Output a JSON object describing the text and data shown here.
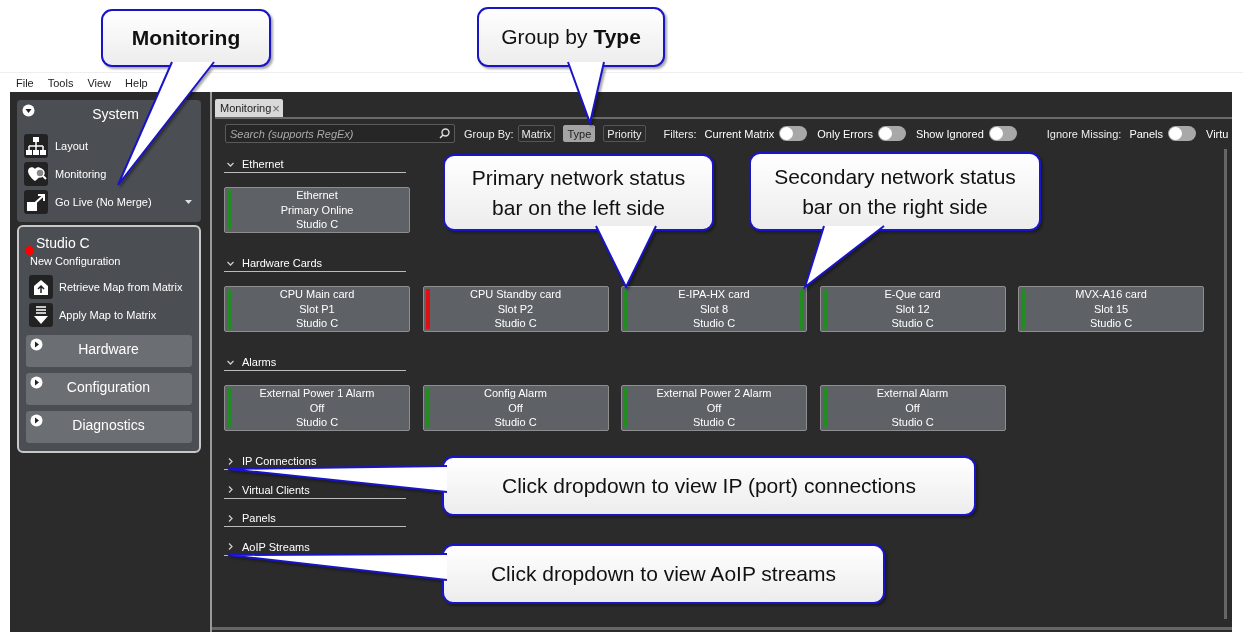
{
  "menu": [
    "File",
    "Tools",
    "View",
    "Help"
  ],
  "sidebar": {
    "system": {
      "title": "System",
      "expanded": true,
      "items": [
        {
          "label": "Layout",
          "dropdown": false
        },
        {
          "label": "Monitoring",
          "dropdown": false
        },
        {
          "label": "Go Live (No Merge)",
          "dropdown": true
        }
      ]
    },
    "matrix": {
      "name": "Studio C",
      "color": "#ff0000",
      "subtitle": "New Configuration",
      "actions": [
        "Retrieve Map from Matrix",
        "Apply Map to Matrix"
      ],
      "sections": [
        {
          "title": "Hardware",
          "expanded": false
        },
        {
          "title": "Configuration",
          "expanded": false
        },
        {
          "title": "Diagnostics",
          "expanded": false
        }
      ]
    }
  },
  "tabs": [
    {
      "label": "Monitoring",
      "selected": true,
      "close": "×"
    }
  ],
  "toolbar": {
    "search": {
      "placeholder": "Search (supports RegEx)"
    },
    "group_by": {
      "label": "Group By:",
      "options": [
        {
          "label": "Matrix",
          "selected": false
        },
        {
          "label": "Type",
          "selected": true
        },
        {
          "label": "Priority",
          "selected": false
        }
      ]
    },
    "filters": {
      "label": "Filters:",
      "toggles": [
        {
          "label": "Current Matrix",
          "on": false
        },
        {
          "label": "Only Errors",
          "on": false
        },
        {
          "label": "Show Ignored",
          "on": false
        }
      ]
    },
    "ignore_missing": {
      "label": "Ignore Missing:",
      "toggles": [
        {
          "label": "Panels",
          "on": false
        },
        {
          "label": "Virtu"
        }
      ]
    }
  },
  "groups": [
    {
      "title": "Ethernet",
      "expanded": true,
      "cards": [
        {
          "lines": [
            "Ethernet",
            "Primary Online",
            "Studio C"
          ],
          "color": "#228b22"
        }
      ]
    },
    {
      "title": "Hardware Cards",
      "expanded": true,
      "cards": [
        {
          "lines": [
            "CPU Main card",
            "Slot P1",
            "Studio C"
          ],
          "color": "#228b22"
        },
        {
          "lines": [
            "CPU Standby card",
            "Slot P2",
            "Studio C"
          ],
          "color": "#e01010"
        },
        {
          "lines": [
            "E-IPA-HX card",
            "Slot 8",
            "Studio C"
          ],
          "color": "#228b22",
          "secondary": {
            "color": "#228b22"
          }
        },
        {
          "lines": [
            "E-Que card",
            "Slot 12",
            "Studio C"
          ],
          "color": "#228b22"
        },
        {
          "lines": [
            "MVX-A16 card",
            "Slot 15",
            "Studio C"
          ],
          "color": "#228b22"
        }
      ]
    },
    {
      "title": "Alarms",
      "expanded": true,
      "cards": [
        {
          "lines": [
            "External Power 1 Alarm",
            "Off",
            "Studio C"
          ],
          "color": "#228b22"
        },
        {
          "lines": [
            "Config Alarm",
            "Off",
            "Studio C"
          ],
          "color": "#228b22"
        },
        {
          "lines": [
            "External Power 2 Alarm",
            "Off",
            "Studio C"
          ],
          "color": "#228b22"
        },
        {
          "lines": [
            "External Alarm",
            "Off",
            "Studio C"
          ],
          "color": "#228b22"
        }
      ]
    },
    {
      "title": "IP Connections",
      "expanded": false
    },
    {
      "title": "Virtual Clients",
      "expanded": false
    },
    {
      "title": "Panels",
      "expanded": false
    },
    {
      "title": "AoIP Streams",
      "expanded": false
    }
  ],
  "callouts": [
    {
      "text": "Monitoring",
      "bold": true
    },
    {
      "text": "Group by **Type**",
      "bold": false
    },
    {
      "text": "Primary network status bar on the left side",
      "bold": false
    },
    {
      "text": "Secondary network status bar on the right side",
      "bold": false
    },
    {
      "text": "Click dropdown to view IP (port) connections",
      "bold": false
    },
    {
      "text": "Click dropdown to view AoIP streams",
      "bold": false
    }
  ]
}
